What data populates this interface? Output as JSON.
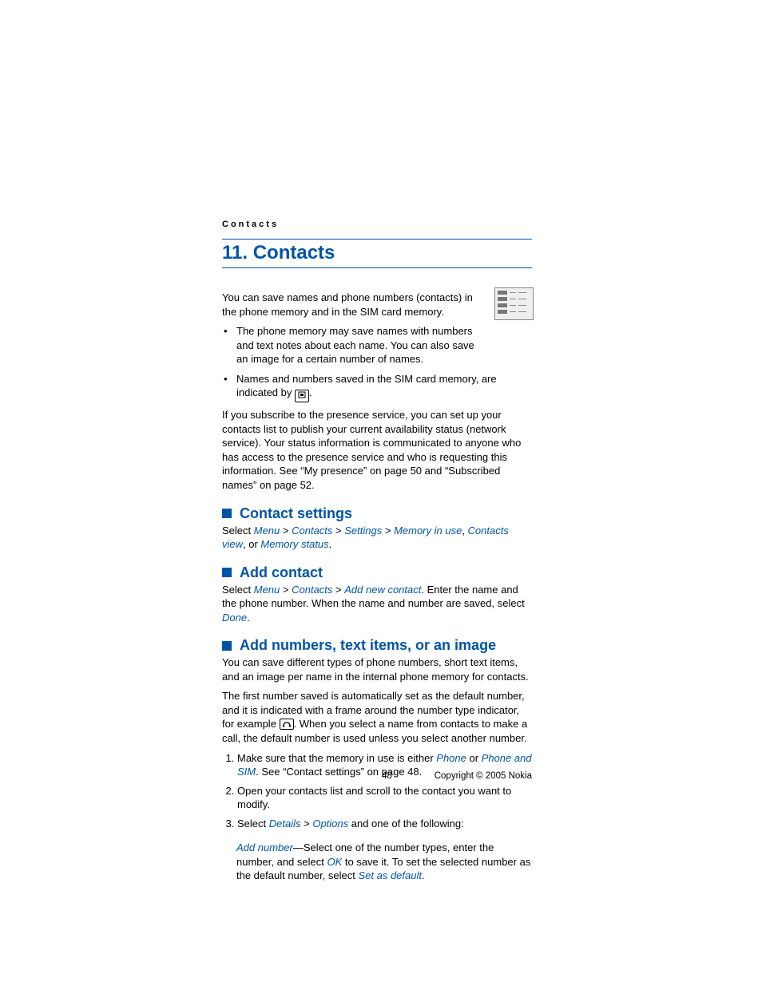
{
  "header": {
    "running": "Contacts"
  },
  "chapter": {
    "title": "11. Contacts"
  },
  "intro": {
    "p1": "You can save names and phone numbers (contacts) in the phone memory and in the SIM card memory.",
    "b1": "The phone memory may save names with numbers and text notes about each name. You can also save an image for a certain number of names.",
    "b2_pre": "Names and numbers saved in the SIM card memory, are indicated by ",
    "b2_post": ".",
    "p2": "If you subscribe to the presence service, you can set up your contacts list to publish your current availability status (network service). Your status information is communicated to anyone who has access to the presence service and who is requesting this information. See “My presence” on page 50 and “Subscribed names” on page 52."
  },
  "s1": {
    "title": "Contact settings",
    "select": "Select ",
    "menu": "Menu",
    "gt": " > ",
    "contacts": "Contacts",
    "settings": "Settings",
    "memory_in_use": "Memory in use",
    "comma": ", ",
    "contacts_view": "Contacts view",
    "or": ", or ",
    "memory_status": "Memory status",
    "period": "."
  },
  "s2": {
    "title": "Add contact",
    "select": "Select ",
    "menu": "Menu",
    "gt": " > ",
    "contacts": "Contacts",
    "add_new_contact": "Add new contact",
    "tail1": ". Enter the name and the phone number. When the name and number are saved, select ",
    "done": "Done",
    "period": "."
  },
  "s3": {
    "title": "Add numbers, text items, or an image",
    "p1": "You can save different types of phone numbers, short text items, and an image per name in the internal phone memory for contacts.",
    "p2_pre": "The first number saved is automatically set as the default number, and it is indicated with a frame around the number type indicator, for example ",
    "p2_post": ". When you select a name from contacts to make a call, the default number is used unless you select another number.",
    "li1_pre": "Make sure that the memory in use is either ",
    "phone": "Phone",
    "li1_or": " or ",
    "phone_and_sim": "Phone and SIM",
    "li1_post": ". See “Contact settings” on page 48.",
    "li2": "Open your contacts list and scroll to the contact you want to modify.",
    "li3_pre": "Select ",
    "details": "Details",
    "gt": " > ",
    "options": "Options",
    "li3_post": " and one of the following:",
    "sub_pre": "",
    "add_number": "Add number",
    "sub_mid1": "—Select one of the number types, enter the number, and select ",
    "ok": "OK",
    "sub_mid2": " to save it. To set the selected number as the default number, select ",
    "set_as_default": "Set as default",
    "period": "."
  },
  "footer": {
    "page": "48",
    "copyright": "Copyright © 2005 Nokia"
  }
}
